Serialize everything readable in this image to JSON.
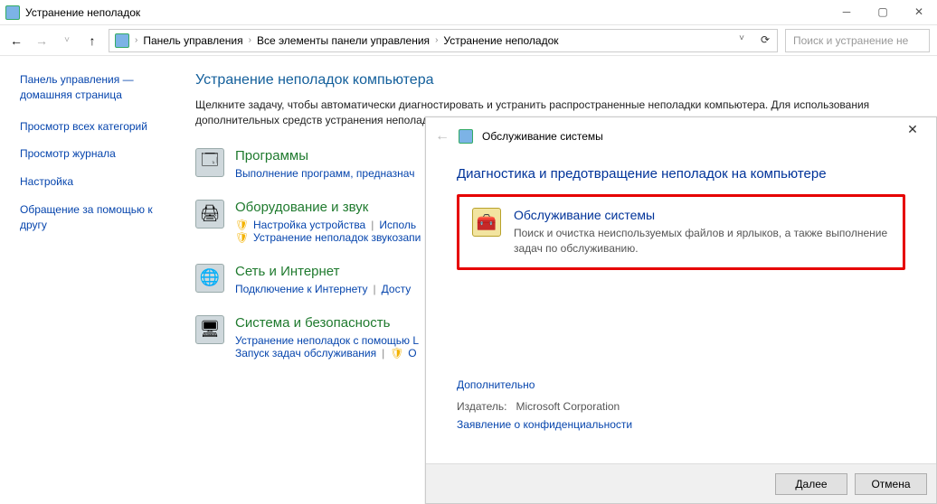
{
  "window": {
    "title": "Устранение неполадок"
  },
  "breadcrumb": {
    "items": [
      "Панель управления",
      "Все элементы панели управления",
      "Устранение неполадок"
    ]
  },
  "search": {
    "placeholder": "Поиск и устранение не"
  },
  "sidebar": {
    "home_label": "Панель управления — домашняя страница",
    "links": [
      "Просмотр всех категорий",
      "Просмотр журнала",
      "Настройка",
      "Обращение за помощью к другу"
    ]
  },
  "main": {
    "heading": "Устранение неполадок компьютера",
    "intro": "Щелкните задачу, чтобы автоматически диагностировать и устранить распространенные неполадки компьютера. Для использования дополнительных средств устранения неполадок щелкните категорию",
    "categories": [
      {
        "title": "Программы",
        "links": [
          "Выполнение программ, предназнач"
        ]
      },
      {
        "title": "Оборудование и звук",
        "links": [
          "Настройка устройства",
          "Исполь",
          "Устранение неполадок звукозапи"
        ],
        "shield_idx": [
          0,
          2
        ]
      },
      {
        "title": "Сеть и Интернет",
        "links": [
          "Подключение к Интернету",
          "Досту"
        ]
      },
      {
        "title": "Система и безопасность",
        "links": [
          "Устранение неполадок с помощью L",
          "Запуск задач обслуживания",
          "О"
        ],
        "shield_idx": [
          2
        ]
      }
    ]
  },
  "wizard": {
    "title": "Обслуживание системы",
    "heading": "Диагностика и предотвращение неполадок на компьютере",
    "option": {
      "title": "Обслуживание системы",
      "desc": "Поиск и очистка неиспользуемых файлов и ярлыков, а также выполнение задач по обслуживанию."
    },
    "advanced": "Дополнительно",
    "publisher_label": "Издатель:",
    "publisher": "Microsoft Corporation",
    "privacy": "Заявление о конфиденциальности",
    "buttons": {
      "next": "Далее",
      "cancel": "Отмена"
    }
  }
}
